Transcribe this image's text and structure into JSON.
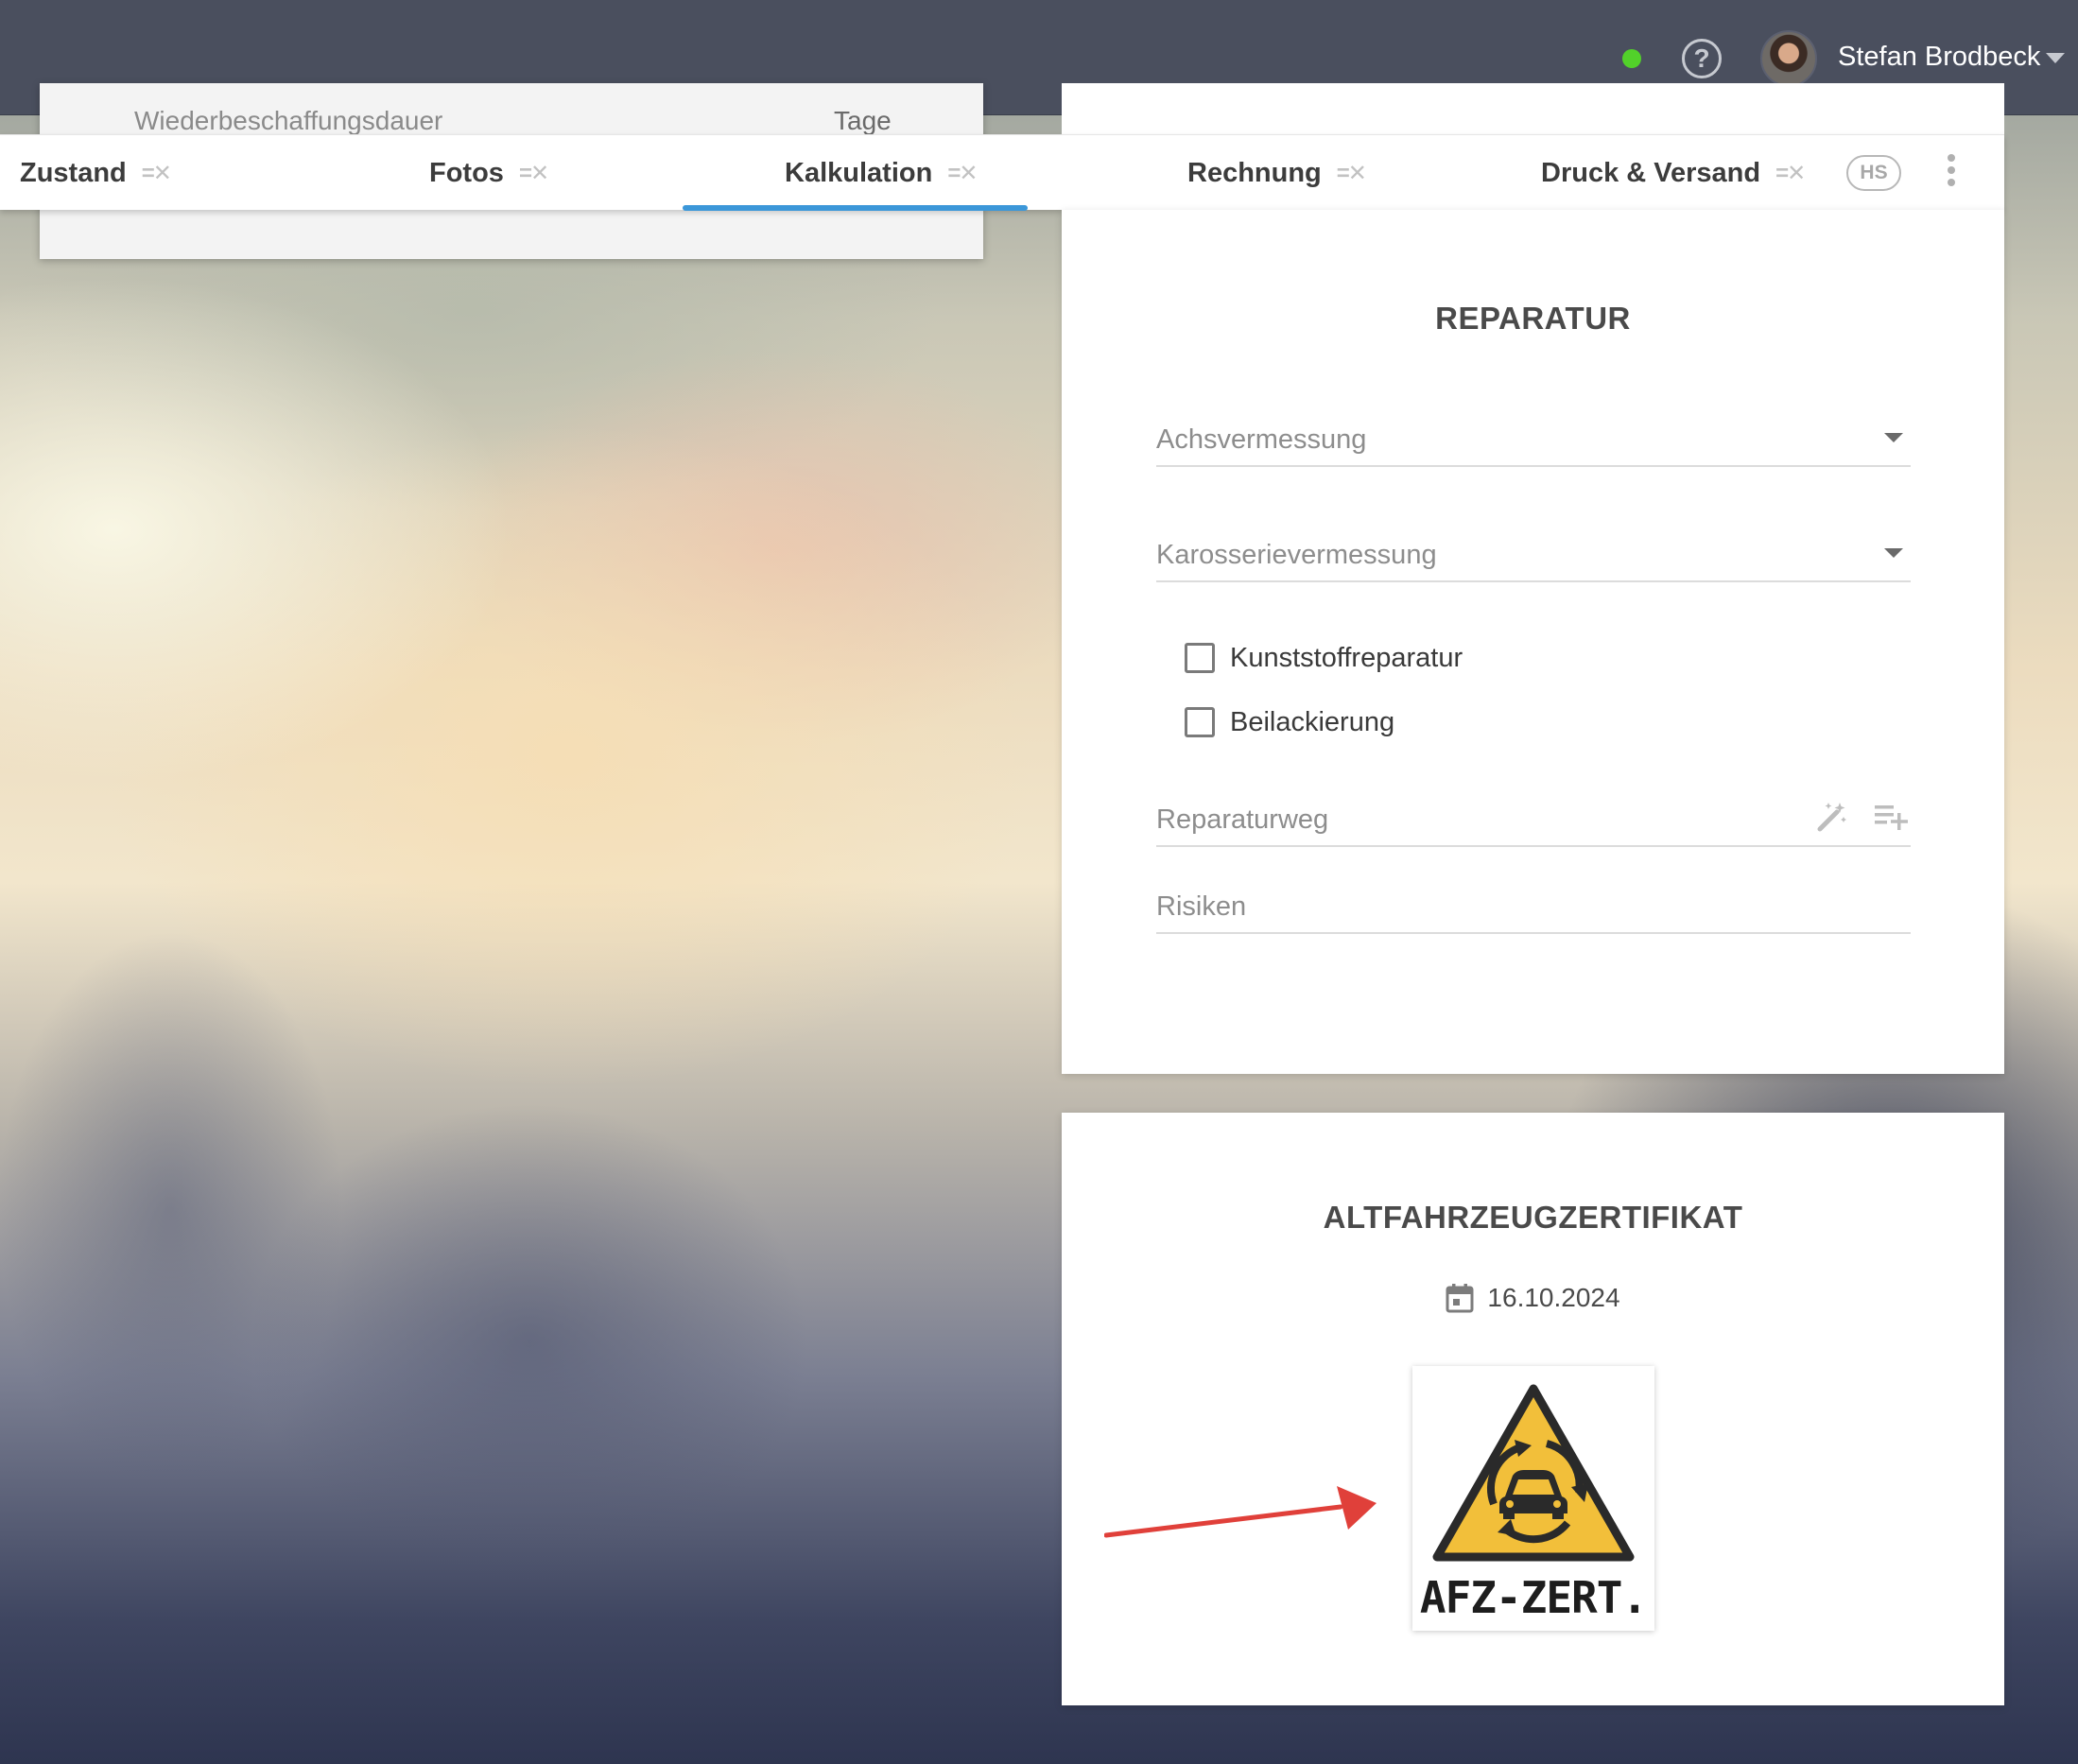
{
  "topbar": {
    "user_name": "Stefan Brodbeck",
    "status_color": "#52d12a",
    "help_icon": "?"
  },
  "background_card": {
    "label": "Wiederbeschaffungsdauer",
    "unit": "Tage"
  },
  "tabs": [
    {
      "label": "Zustand",
      "icon": "checklist-icon"
    },
    {
      "label": "Fotos",
      "icon": "checklist-icon"
    },
    {
      "label": "Kalkulation",
      "icon": "checklist-icon",
      "active": true
    },
    {
      "label": "Rechnung",
      "icon": "checklist-icon"
    },
    {
      "label": "Druck & Versand",
      "icon": "checklist-icon"
    }
  ],
  "tab_icon_glyph": "=✕",
  "hs_badge": "HS",
  "accent_color": "#3b97d9",
  "repair": {
    "title": "REPARATUR",
    "fields": {
      "achsvermessung": "Achsvermessung",
      "karosserievermessung": "Karosserievermessung",
      "reparaturweg": "Reparaturweg",
      "risiken": "Risiken"
    },
    "checkboxes": {
      "kunststoff": {
        "label": "Kunststoffreparatur",
        "checked": false
      },
      "beilackierung": {
        "label": "Beilackierung",
        "checked": false
      }
    }
  },
  "afz": {
    "title": "ALTFAHRZEUGZERTIFIKAT",
    "date": "16.10.2024",
    "logo_text": "AFZ-ZERT.",
    "logo_color": "#f2bf3a"
  },
  "annotation": {
    "color": "#e0403a"
  }
}
